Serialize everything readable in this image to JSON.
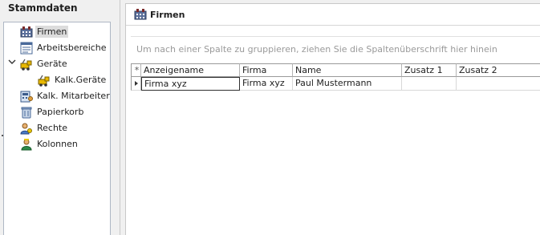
{
  "left": {
    "title": "Stammdaten",
    "items": [
      {
        "label": "Firmen",
        "icon": "company-icon"
      },
      {
        "label": "Arbeitsbereiche",
        "icon": "workarea-icon"
      },
      {
        "label": "Geräte",
        "icon": "device-icon"
      },
      {
        "label": "Kalk.Geräte",
        "icon": "device-icon"
      },
      {
        "label": "Kalk. Mitarbeiter",
        "icon": "calc-employee-icon"
      },
      {
        "label": "Papierkorb",
        "icon": "trash-icon"
      },
      {
        "label": "Rechte",
        "icon": "rights-icon"
      },
      {
        "label": "Kolonnen",
        "icon": "crew-icon"
      }
    ]
  },
  "right": {
    "title": "Firmen",
    "group_hint": "Um nach einer Spalte zu gruppieren, ziehen Sie die Spaltenüberschrift hier hinein"
  },
  "grid": {
    "header_marker": "*",
    "columns": [
      "Anzeigename",
      "Firma",
      "Name",
      "Zusatz 1",
      "Zusatz 2"
    ],
    "rows": [
      [
        "Firma xyz",
        "Firma xyz",
        "Paul Mustermann",
        "",
        ""
      ]
    ]
  },
  "colors": {
    "selection": "#dcdcdc",
    "border": "#aeb7c4"
  }
}
